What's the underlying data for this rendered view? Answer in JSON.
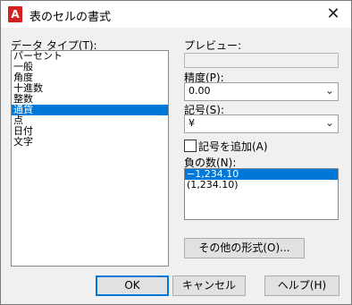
{
  "window": {
    "title": "表のセルの書式",
    "app_icon_letter": "A"
  },
  "data_type": {
    "label": "データ タイプ(T):",
    "items": [
      "パーセント",
      "一般",
      "角度",
      "十進数",
      "整数",
      "通貨",
      "点",
      "日付",
      "文字"
    ],
    "selected": "通貨"
  },
  "preview": {
    "label": "プレビュー:",
    "value": ""
  },
  "precision": {
    "label": "精度(P):",
    "value": "0.00"
  },
  "symbol": {
    "label": "記号(S):",
    "value": "¥"
  },
  "add_symbol": {
    "label": "記号を追加(A)",
    "checked": false
  },
  "negative": {
    "label": "負の数(N):",
    "items": [
      "−1,234.10",
      "(1,234.10)"
    ],
    "selected": "−1,234.10"
  },
  "buttons": {
    "other_format": "その他の形式(O)...",
    "ok": "OK",
    "cancel": "キャンセル",
    "help": "ヘルプ(H)"
  }
}
